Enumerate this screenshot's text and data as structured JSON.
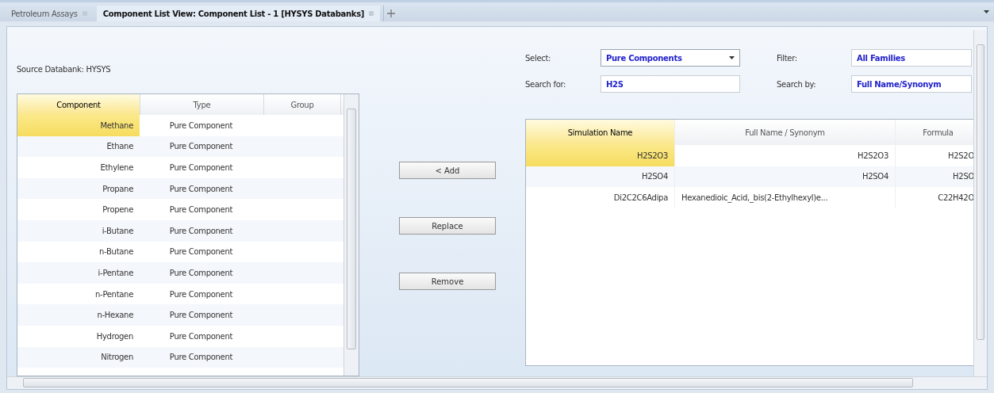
{
  "tabs": [
    {
      "label": "Petroleum Assays",
      "selected": false
    },
    {
      "label": "Component List View: Component List - 1 [HYSYS Databanks]",
      "selected": true
    }
  ],
  "source_label": "Source Databank: HYSYS",
  "component_table": {
    "columns": [
      "Component",
      "Type",
      "Group"
    ],
    "rows": [
      {
        "component": "Methane",
        "type": "Pure Component",
        "selected": true
      },
      {
        "component": "Ethane",
        "type": "Pure Component",
        "selected": false
      },
      {
        "component": "Ethylene",
        "type": "Pure Component",
        "selected": false
      },
      {
        "component": "Propane",
        "type": "Pure Component",
        "selected": false
      },
      {
        "component": "Propene",
        "type": "Pure Component",
        "selected": false
      },
      {
        "component": "i-Butane",
        "type": "Pure Component",
        "selected": false
      },
      {
        "component": "n-Butane",
        "type": "Pure Component",
        "selected": false
      },
      {
        "component": "i-Pentane",
        "type": "Pure Component",
        "selected": false
      },
      {
        "component": "n-Pentane",
        "type": "Pure Component",
        "selected": false
      },
      {
        "component": "n-Hexane",
        "type": "Pure Component",
        "selected": false
      },
      {
        "component": "Hydrogen",
        "type": "Pure Component",
        "selected": false
      },
      {
        "component": "Nitrogen",
        "type": "Pure Component",
        "selected": false
      }
    ]
  },
  "buttons": [
    "< Add",
    "Replace",
    "Remove"
  ],
  "select": {
    "label": "Select:",
    "value": "Pure Components"
  },
  "filter": {
    "label": "Filter:",
    "value": "All Families"
  },
  "search_for": {
    "label": "Search for:",
    "value": "H2S"
  },
  "search_by": {
    "label": "Search by:",
    "value": "Full Name/Synonym"
  },
  "results_table": {
    "columns": [
      "Simulation Name",
      "Full Name / Synonym",
      "Formula"
    ],
    "rows": [
      {
        "simulation_name": "H2S2O3",
        "full_name": "H2S2O3",
        "formula": "H2S2O",
        "selected": true
      },
      {
        "simulation_name": "H2SO4",
        "full_name": "H2SO4",
        "formula": "H2SO",
        "selected": false
      },
      {
        "simulation_name": "Di2C2C6Adipa",
        "full_name": "Hexanedioic_Acid,_bis(2-Ethylhexyl)e...",
        "formula": "C22H42O",
        "selected": false
      }
    ]
  }
}
